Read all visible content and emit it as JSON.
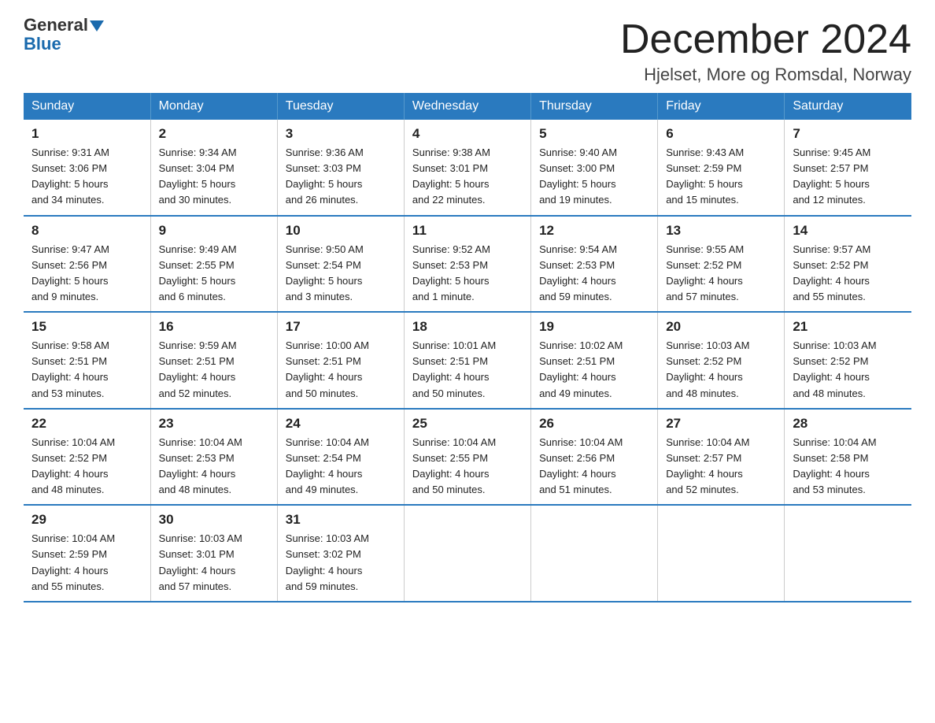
{
  "logo": {
    "line1": "General",
    "line2": "Blue"
  },
  "title": "December 2024",
  "location": "Hjelset, More og Romsdal, Norway",
  "weekdays": [
    "Sunday",
    "Monday",
    "Tuesday",
    "Wednesday",
    "Thursday",
    "Friday",
    "Saturday"
  ],
  "weeks": [
    [
      {
        "day": "1",
        "info": "Sunrise: 9:31 AM\nSunset: 3:06 PM\nDaylight: 5 hours\nand 34 minutes."
      },
      {
        "day": "2",
        "info": "Sunrise: 9:34 AM\nSunset: 3:04 PM\nDaylight: 5 hours\nand 30 minutes."
      },
      {
        "day": "3",
        "info": "Sunrise: 9:36 AM\nSunset: 3:03 PM\nDaylight: 5 hours\nand 26 minutes."
      },
      {
        "day": "4",
        "info": "Sunrise: 9:38 AM\nSunset: 3:01 PM\nDaylight: 5 hours\nand 22 minutes."
      },
      {
        "day": "5",
        "info": "Sunrise: 9:40 AM\nSunset: 3:00 PM\nDaylight: 5 hours\nand 19 minutes."
      },
      {
        "day": "6",
        "info": "Sunrise: 9:43 AM\nSunset: 2:59 PM\nDaylight: 5 hours\nand 15 minutes."
      },
      {
        "day": "7",
        "info": "Sunrise: 9:45 AM\nSunset: 2:57 PM\nDaylight: 5 hours\nand 12 minutes."
      }
    ],
    [
      {
        "day": "8",
        "info": "Sunrise: 9:47 AM\nSunset: 2:56 PM\nDaylight: 5 hours\nand 9 minutes."
      },
      {
        "day": "9",
        "info": "Sunrise: 9:49 AM\nSunset: 2:55 PM\nDaylight: 5 hours\nand 6 minutes."
      },
      {
        "day": "10",
        "info": "Sunrise: 9:50 AM\nSunset: 2:54 PM\nDaylight: 5 hours\nand 3 minutes."
      },
      {
        "day": "11",
        "info": "Sunrise: 9:52 AM\nSunset: 2:53 PM\nDaylight: 5 hours\nand 1 minute."
      },
      {
        "day": "12",
        "info": "Sunrise: 9:54 AM\nSunset: 2:53 PM\nDaylight: 4 hours\nand 59 minutes."
      },
      {
        "day": "13",
        "info": "Sunrise: 9:55 AM\nSunset: 2:52 PM\nDaylight: 4 hours\nand 57 minutes."
      },
      {
        "day": "14",
        "info": "Sunrise: 9:57 AM\nSunset: 2:52 PM\nDaylight: 4 hours\nand 55 minutes."
      }
    ],
    [
      {
        "day": "15",
        "info": "Sunrise: 9:58 AM\nSunset: 2:51 PM\nDaylight: 4 hours\nand 53 minutes."
      },
      {
        "day": "16",
        "info": "Sunrise: 9:59 AM\nSunset: 2:51 PM\nDaylight: 4 hours\nand 52 minutes."
      },
      {
        "day": "17",
        "info": "Sunrise: 10:00 AM\nSunset: 2:51 PM\nDaylight: 4 hours\nand 50 minutes."
      },
      {
        "day": "18",
        "info": "Sunrise: 10:01 AM\nSunset: 2:51 PM\nDaylight: 4 hours\nand 50 minutes."
      },
      {
        "day": "19",
        "info": "Sunrise: 10:02 AM\nSunset: 2:51 PM\nDaylight: 4 hours\nand 49 minutes."
      },
      {
        "day": "20",
        "info": "Sunrise: 10:03 AM\nSunset: 2:52 PM\nDaylight: 4 hours\nand 48 minutes."
      },
      {
        "day": "21",
        "info": "Sunrise: 10:03 AM\nSunset: 2:52 PM\nDaylight: 4 hours\nand 48 minutes."
      }
    ],
    [
      {
        "day": "22",
        "info": "Sunrise: 10:04 AM\nSunset: 2:52 PM\nDaylight: 4 hours\nand 48 minutes."
      },
      {
        "day": "23",
        "info": "Sunrise: 10:04 AM\nSunset: 2:53 PM\nDaylight: 4 hours\nand 48 minutes."
      },
      {
        "day": "24",
        "info": "Sunrise: 10:04 AM\nSunset: 2:54 PM\nDaylight: 4 hours\nand 49 minutes."
      },
      {
        "day": "25",
        "info": "Sunrise: 10:04 AM\nSunset: 2:55 PM\nDaylight: 4 hours\nand 50 minutes."
      },
      {
        "day": "26",
        "info": "Sunrise: 10:04 AM\nSunset: 2:56 PM\nDaylight: 4 hours\nand 51 minutes."
      },
      {
        "day": "27",
        "info": "Sunrise: 10:04 AM\nSunset: 2:57 PM\nDaylight: 4 hours\nand 52 minutes."
      },
      {
        "day": "28",
        "info": "Sunrise: 10:04 AM\nSunset: 2:58 PM\nDaylight: 4 hours\nand 53 minutes."
      }
    ],
    [
      {
        "day": "29",
        "info": "Sunrise: 10:04 AM\nSunset: 2:59 PM\nDaylight: 4 hours\nand 55 minutes."
      },
      {
        "day": "30",
        "info": "Sunrise: 10:03 AM\nSunset: 3:01 PM\nDaylight: 4 hours\nand 57 minutes."
      },
      {
        "day": "31",
        "info": "Sunrise: 10:03 AM\nSunset: 3:02 PM\nDaylight: 4 hours\nand 59 minutes."
      },
      {
        "day": "",
        "info": ""
      },
      {
        "day": "",
        "info": ""
      },
      {
        "day": "",
        "info": ""
      },
      {
        "day": "",
        "info": ""
      }
    ]
  ]
}
